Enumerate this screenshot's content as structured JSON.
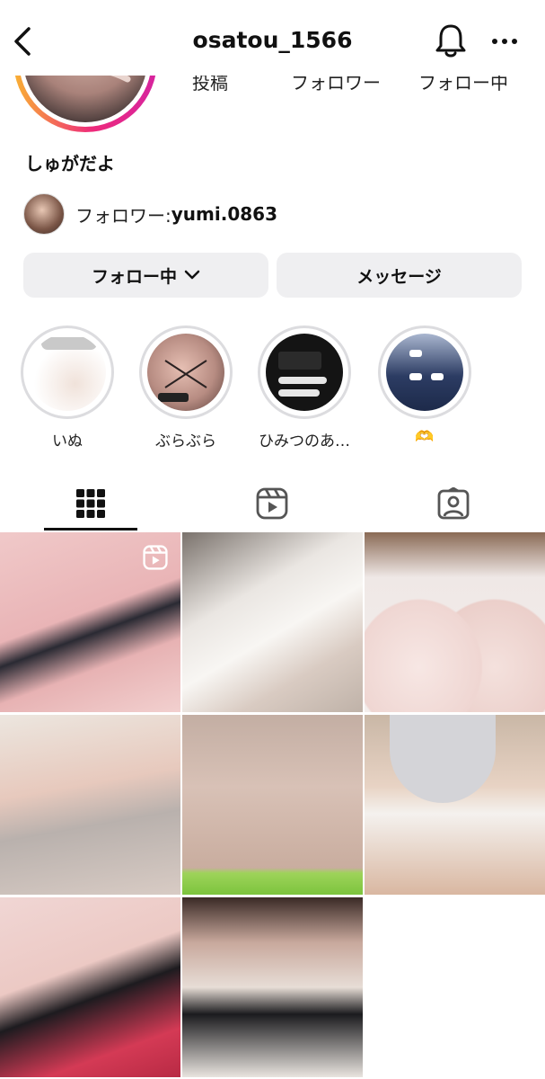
{
  "header": {
    "username": "osatou_1566",
    "back_icon": "chevron-left-icon",
    "notification_icon": "bell-icon",
    "more_icon": "more-horizontal-icon"
  },
  "profile": {
    "stats": [
      {
        "label": "投稿"
      },
      {
        "label": "フォロワー"
      },
      {
        "label": "フォロー中"
      }
    ],
    "display_name": "しゅがだよ",
    "followed_by": {
      "prefix": "フォロワー: ",
      "username": "yumi.0863"
    }
  },
  "actions": {
    "following_label": "フォロー中",
    "message_label": "メッセージ"
  },
  "highlights": [
    {
      "label": "いぬ"
    },
    {
      "label": "ぶらぶら"
    },
    {
      "label": "ひみつのあ…"
    },
    {
      "label": "🫶"
    }
  ],
  "tabs": [
    {
      "name": "grid",
      "icon": "grid-icon",
      "active": true
    },
    {
      "name": "reels",
      "icon": "reels-icon",
      "active": false
    },
    {
      "name": "tagged",
      "icon": "tagged-user-icon",
      "active": false
    }
  ],
  "posts": [
    {
      "type": "reel"
    },
    {
      "type": "photo"
    },
    {
      "type": "photo"
    },
    {
      "type": "photo"
    },
    {
      "type": "photo"
    },
    {
      "type": "photo"
    },
    {
      "type": "photo"
    },
    {
      "type": "photo"
    }
  ],
  "colors": {
    "button_bg": "#efeff1",
    "ring_gradient_start": "#f9b233",
    "ring_gradient_end": "#d6249f",
    "highlight_ring": "#dcdcdf"
  }
}
